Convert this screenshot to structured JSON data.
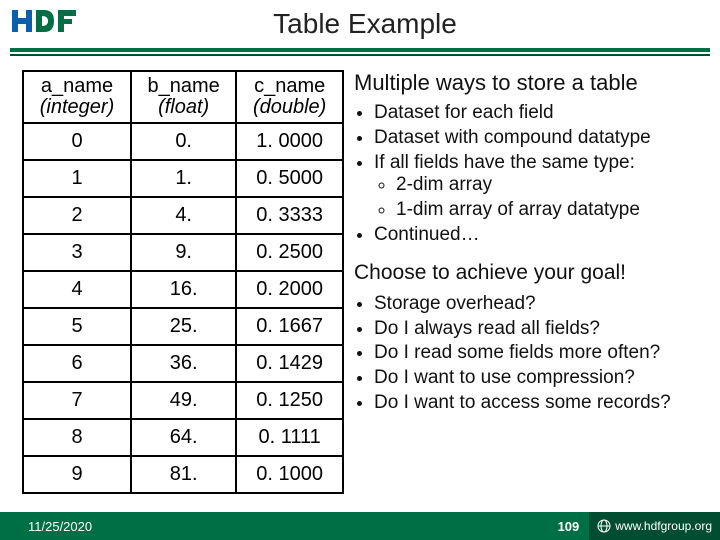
{
  "title": "Table Example",
  "table": {
    "headers": [
      {
        "name": "a_name",
        "type": "(integer)"
      },
      {
        "name": "b_name",
        "type": "(float)"
      },
      {
        "name": "c_name",
        "type": "(double)"
      }
    ],
    "rows": [
      {
        "a": "0",
        "b": "0.",
        "c": "1. 0000"
      },
      {
        "a": "1",
        "b": "1.",
        "c": "0. 5000"
      },
      {
        "a": "2",
        "b": "4.",
        "c": "0. 3333"
      },
      {
        "a": "3",
        "b": "9.",
        "c": "0. 2500"
      },
      {
        "a": "4",
        "b": "16.",
        "c": "0. 2000"
      },
      {
        "a": "5",
        "b": "25.",
        "c": "0. 1667"
      },
      {
        "a": "6",
        "b": "36.",
        "c": "0. 1429"
      },
      {
        "a": "7",
        "b": "49.",
        "c": "0. 1250"
      },
      {
        "a": "8",
        "b": "64.",
        "c": "0. 1111"
      },
      {
        "a": "9",
        "b": "81.",
        "c": "0. 1000"
      }
    ]
  },
  "right": {
    "heading1": "Multiple ways to store a table",
    "bullets1": [
      "Dataset for each field",
      "Dataset with compound datatype",
      "If all fields have the same type:",
      "Continued…"
    ],
    "sub1": [
      "2-dim array",
      "1-dim array of array datatype"
    ],
    "heading2": "Choose to achieve your goal!",
    "bullets2": [
      "Storage overhead?",
      "Do I always read all fields?",
      "Do I read some fields more often?",
      "Do I want to use compression?",
      "Do I want to access some records?"
    ]
  },
  "footer": {
    "date": "11/25/2020",
    "page": "109",
    "site": "www.hdfgroup.org"
  }
}
